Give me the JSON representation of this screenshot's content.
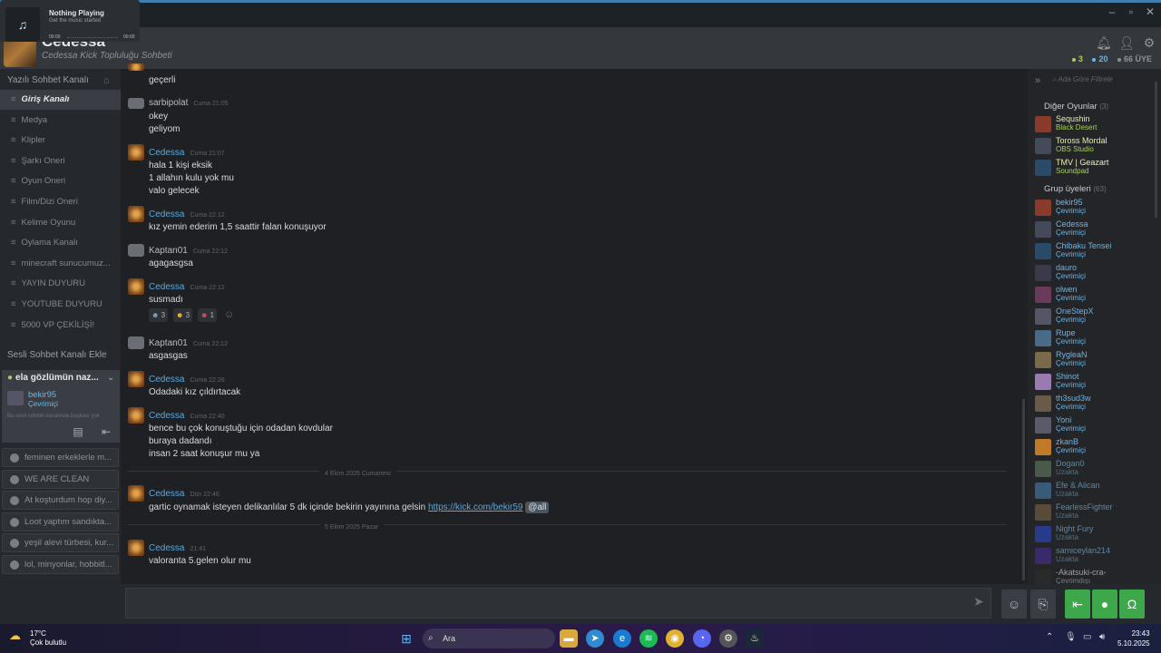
{
  "media": {
    "title": "Nothing Playing",
    "subtitle": "Get the music started",
    "time_start": "00:00",
    "time_end": "00:00",
    "icon": "music-note-icon"
  },
  "header": {
    "group_name": "Cedessa",
    "group_sub": "Cedessa Kick Topluluğu Sohbeti",
    "count_ingame": "3",
    "count_online": "20",
    "count_members": "66 ÜYE"
  },
  "left": {
    "text_section": "Yazılı Sohbet Kanalı",
    "channels": [
      "Giriş Kanalı",
      "Medya",
      "Klipler",
      "Şarkı Oneri",
      "Oyun Oneri",
      "Film/Dizi Oneri",
      "Kelime Oyunu",
      "Oylama Kanalı",
      "minecraft sunucumuz...",
      "YAYIN DUYURU",
      "YOUTUBE DUYURU",
      "5000 VP ÇEKİLİŞİ!"
    ],
    "voice_section": "Sesli Sohbet Kanalı Ekle",
    "voice_channel": "ela gözlümün naz...",
    "voice_user": "bekir95",
    "voice_user_status": "Çevrimiçi",
    "voice_hint": "Bu sesli sohbet kanalında başkası yok",
    "voice_list": [
      "feminen erkeklerle m...",
      "WE ARE CLEAN",
      "At koşturdum hop diy...",
      "Loot yaptım sandıkta...",
      "yeşil alevi türbesi, kur...",
      "lol, minyonlar, hobbitl..."
    ]
  },
  "messages": {
    "m0_text": "geçerli",
    "m1_author": "sarbipolat",
    "m1_time": "Cuma 21:05",
    "m1_l1": "okey",
    "m1_l2": "geliyom",
    "m2_author": "Cedessa",
    "m2_time": "Cuma 21:07",
    "m2_l1": "hala 1 kişi eksik",
    "m2_l2": "1 allahın kulu yok mu",
    "m2_l3": "valo gelecek",
    "m3_author": "Cedessa",
    "m3_time": "Cuma 22:12",
    "m3_l1": "kız yemin ederim 1,5 saattir falan konuşuyor",
    "m4_author": "Kaptan01",
    "m4_time": "Cuma 22:12",
    "m4_l1": "agagasgsa",
    "m5_author": "Cedessa",
    "m5_time": "Cuma 22:12",
    "m5_l1": "susmadı",
    "react1": "3",
    "react2": "3",
    "react3": "1",
    "m6_author": "Kaptan01",
    "m6_time": "Cuma 22:12",
    "m6_l1": "asgasgas",
    "m7_author": "Cedessa",
    "m7_time": "Cuma 22:26",
    "m7_l1": "Odadaki kız çıldırtacak",
    "m8_author": "Cedessa",
    "m8_time": "Cuma 22:40",
    "m8_l1": "bence bu çok konuştuğu için odadan kovdular",
    "m8_l2": "buraya dadandı",
    "m8_l3": "insan 2 saat konuşur mu ya",
    "sep1": "4 Ekim 2025 Cumartesi",
    "m9_author": "Cedessa",
    "m9_time": "Dün 22:46",
    "m9_l1": "gartic oynamak isteyen delikanlılar 5 dk içinde bekirin yayınına gelsin",
    "m9_link": "https://kick.com/bekir59",
    "m9_at": "@all",
    "sep2": "5 Ekim 2025 Pazar",
    "m10_author": "Cedessa",
    "m10_time": "21:41",
    "m10_l1": "valoranta 5.gelen olur mu"
  },
  "right": {
    "filter_placeholder": "Ada Göre Filtrele",
    "games_head": "Diğer Oyunlar",
    "games_count": "(3)",
    "games": [
      {
        "name": "Sequshin",
        "status": "Black Desert"
      },
      {
        "name": "Toross Mordal",
        "status": "OBS Studio"
      },
      {
        "name": "TMV | Geazart",
        "status": "Soundpad"
      }
    ],
    "group_head": "Grup üyeleri",
    "group_count": "(63)",
    "members": [
      {
        "name": "bekir95",
        "status": "Çevrimiçi"
      },
      {
        "name": "Cedessa",
        "status": "Çevrimiçi"
      },
      {
        "name": "Chibaku Tensei",
        "status": "Çevrimiçi"
      },
      {
        "name": "dauro",
        "status": "Çevrimiçi"
      },
      {
        "name": "olwen",
        "status": "Çevrimiçi"
      },
      {
        "name": "OneStepX",
        "status": "Çevrimiçi"
      },
      {
        "name": "Rupe",
        "status": "Çevrimiçi"
      },
      {
        "name": "RygleaN",
        "status": "Çevrimiçi"
      },
      {
        "name": "Shinot",
        "status": "Çevrimiçi"
      },
      {
        "name": "th3sud3w",
        "status": "Çevrimiçi"
      },
      {
        "name": "Yoni",
        "status": "Çevrimiçi"
      },
      {
        "name": "zkanB",
        "status": "Çevrimiçi"
      },
      {
        "name": "Dogan0",
        "status": "Uzakta"
      },
      {
        "name": "Efe & Alican",
        "status": "Uzakta"
      },
      {
        "name": "FearlessFighter",
        "status": "Uzakta"
      },
      {
        "name": "Night Fury",
        "status": "Uzakta"
      },
      {
        "name": "samiceylan214",
        "status": "Uzakta"
      },
      {
        "name": "-Akatsuki-cra-",
        "status": "Çevrimdışı"
      }
    ]
  },
  "taskbar": {
    "temp": "17°C",
    "weather": "Çok bulutlu",
    "search": "Ara",
    "time": "23:43",
    "date": "5.10.2025"
  },
  "colors": {
    "accent": "#5aa9e0",
    "ingame": "#a8d060",
    "voice_green": "#3ca84a"
  }
}
